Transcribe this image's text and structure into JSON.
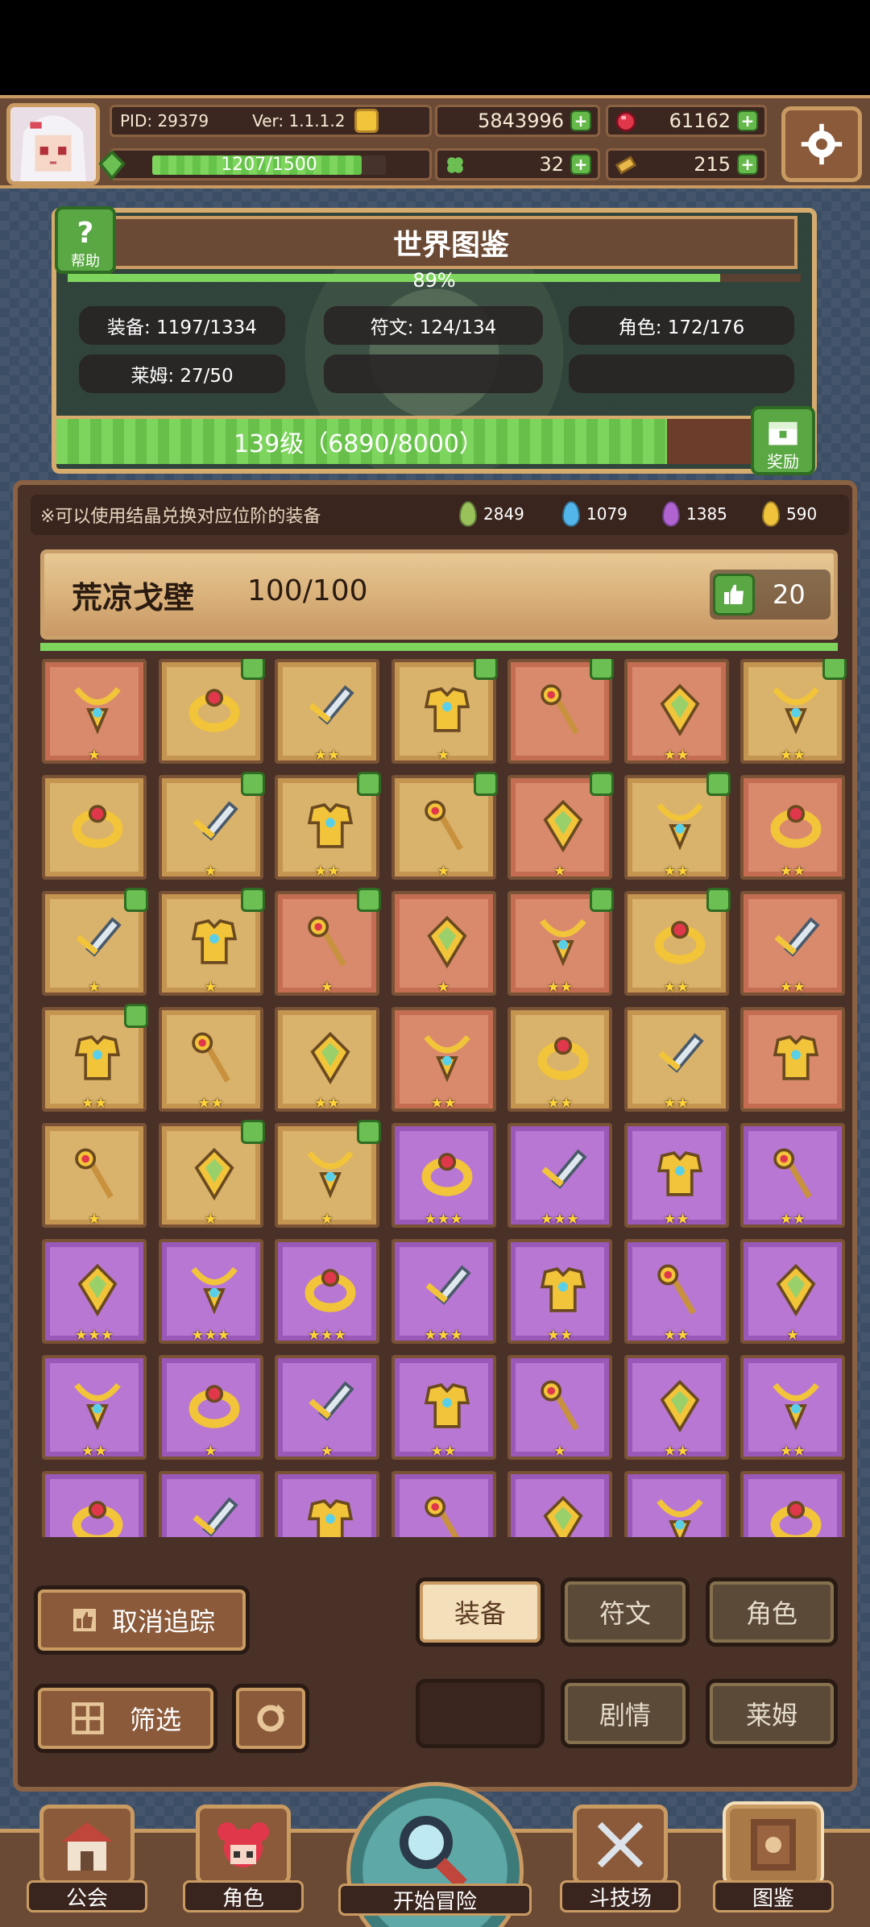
{
  "header": {
    "pid": "PID: 29379",
    "version": "Ver: 1.1.1.2",
    "gold": "5843996",
    "gems": "61162",
    "exp": "1207/1500",
    "clover": "32",
    "tickets": "215"
  },
  "atlas": {
    "title": "世界图鉴",
    "help_label": "帮助",
    "percent": "89%",
    "percent_value": 0.89,
    "stats": {
      "equipment": "装备: 1197/1334",
      "runes": "符文: 124/134",
      "characters": "角色: 172/176",
      "slime": "莱姆: 27/50"
    },
    "level": "139级（6890/8000）",
    "level_progress": 0.861,
    "reward_label": "奖励"
  },
  "equipment": {
    "note": "※可以使用结晶兑换对应位阶的装备",
    "crystals": {
      "green": "2849",
      "blue": "1079",
      "purple": "1385",
      "gold": "590"
    },
    "region": {
      "name": "荒凉戈壁",
      "count": "100/100",
      "likes": "20"
    }
  },
  "buttons": {
    "untrack": "取消追踪",
    "filter": "筛选",
    "tab_equipment": "装备",
    "tab_runes": "符文",
    "tab_characters": "角色",
    "tab_story": "剧情",
    "tab_slime": "莱姆"
  },
  "nav": {
    "guild": "公会",
    "characters": "角色",
    "start": "开始冒险",
    "arena": "斗技场",
    "atlas": "图鉴"
  },
  "colors": {
    "green": "#7ed55e",
    "brown": "#6b4a35",
    "gold": "#f2c43a"
  }
}
